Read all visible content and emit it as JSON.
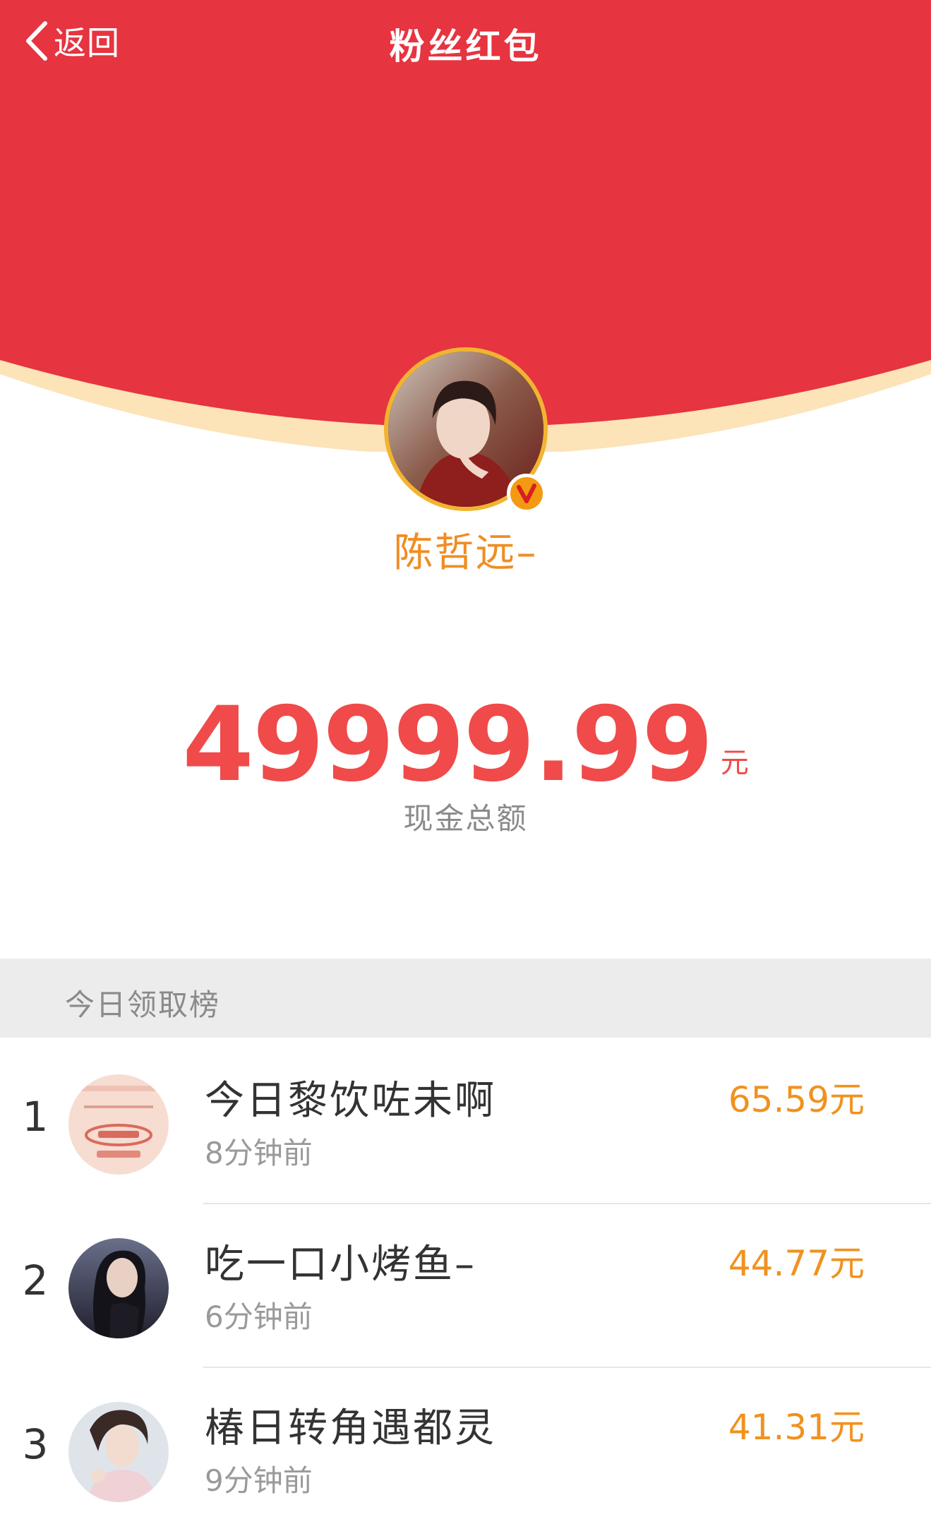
{
  "colors": {
    "envelope_red": "#e63440",
    "envelope_rim": "#fce3b8",
    "accent_orange": "#f08d23",
    "amount_red": "#f04a4a"
  },
  "nav": {
    "back_label": "返回",
    "title": "粉丝红包"
  },
  "host": {
    "name": "陈哲远–",
    "verified_badge": "v-badge-icon"
  },
  "total": {
    "amount": "49999.99",
    "unit": "元",
    "label": "现金总额"
  },
  "ranking": {
    "header": "今日领取榜",
    "rows": [
      {
        "rank": "1",
        "name": "今日黎饮咗未啊",
        "time": "8分钟前",
        "amount": "65.59元"
      },
      {
        "rank": "2",
        "name": "吃一口小烤鱼–",
        "time": "6分钟前",
        "amount": "44.77元"
      },
      {
        "rank": "3",
        "name": "椿日转角遇都灵",
        "time": "9分钟前",
        "amount": "41.31元"
      }
    ]
  }
}
